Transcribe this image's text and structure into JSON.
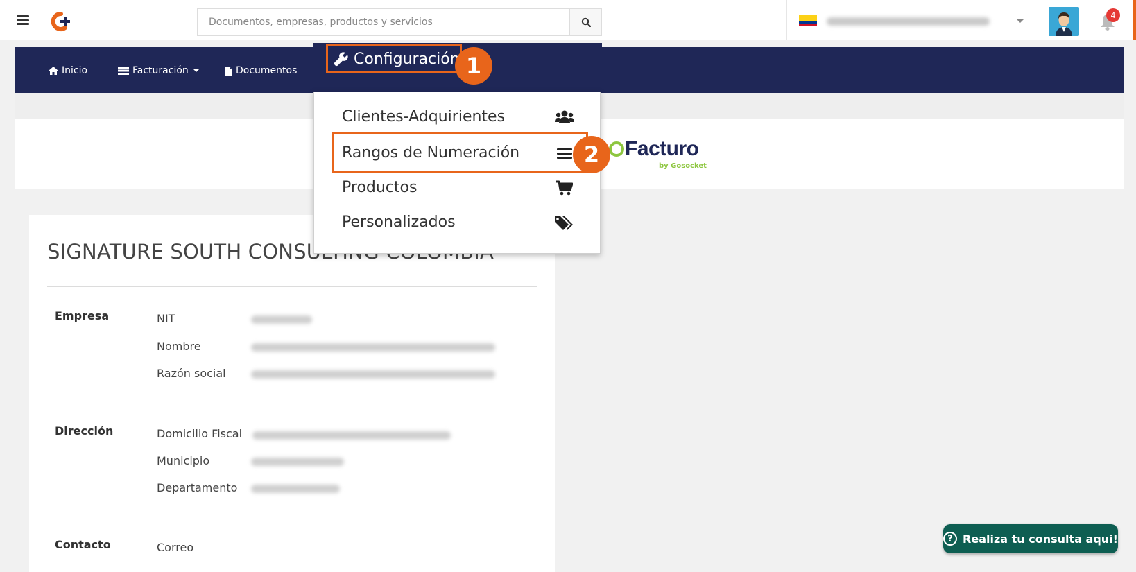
{
  "topbar": {
    "search_placeholder": "Documentos, empresas, productos y servicios",
    "notification_count": "4",
    "company_selector": "SIGNATURE SOUTH CONSUL..."
  },
  "nav": {
    "inicio": "Inicio",
    "facturacion": "Facturación",
    "documentos": "Documentos",
    "configuracion": "Configuración"
  },
  "dropdown": {
    "items": [
      {
        "label": "Clientes-Adquirientes",
        "icon": "users-icon"
      },
      {
        "label": "Rangos de Numeración",
        "icon": "list-icon"
      },
      {
        "label": "Productos",
        "icon": "cart-icon"
      },
      {
        "label": "Personalizados",
        "icon": "tags-icon"
      }
    ]
  },
  "steps": {
    "one": "1",
    "two": "2"
  },
  "brand": {
    "name": "Facturo",
    "tagline": "by Gosocket"
  },
  "company": {
    "title": "SIGNATURE SOUTH CONSULTING COLOMBIA",
    "sections": {
      "empresa": "Empresa",
      "direccion": "Dirección",
      "contacto": "Contacto"
    },
    "fields": {
      "nit": "NIT",
      "nombre": "Nombre",
      "razon_social": "Razón social",
      "domicilio_fiscal": "Domicilio Fiscal",
      "municipio": "Municipio",
      "departamento": "Departamento",
      "correo": "Correo"
    }
  },
  "help": {
    "label": "Realiza tu consulta aqui!"
  },
  "colors": {
    "nav_bg": "#1f2757",
    "accent": "#e8651b",
    "help_bg": "#0e5e52",
    "brand_green": "#8dc63f"
  }
}
